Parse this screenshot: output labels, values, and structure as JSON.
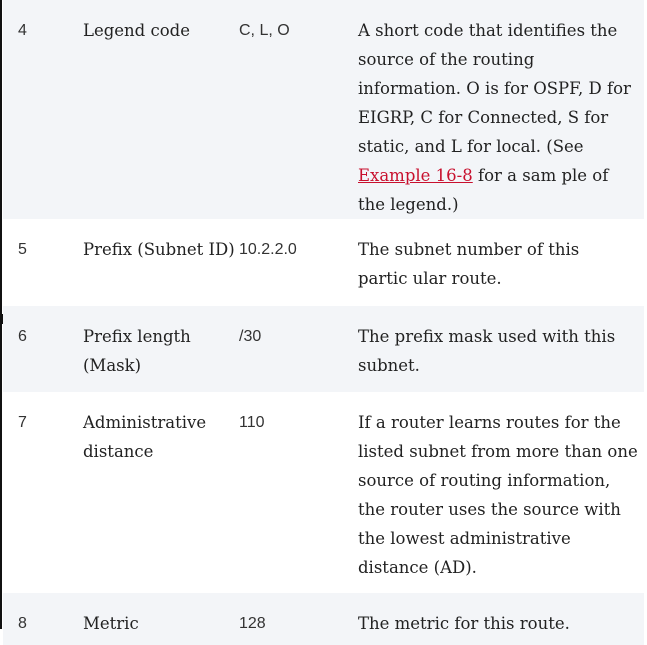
{
  "rows": [
    {
      "number": "4",
      "field": "Legend code",
      "value": "C, L, O",
      "description_before": "A short code that identifies the source of the routing information. O is for OSPF, D for EIGRP, C for Connected, S for static, and L for local. (See ",
      "link": "Example 16-8",
      "description_after": " for a sam­ ple of the legend.)"
    },
    {
      "number": "5",
      "field": "Prefix (Subnet ID)",
      "value": "10.2.2.0",
      "description": "The subnet number of this partic­ ular route."
    },
    {
      "number": "6",
      "field": "Prefix length (Mask)",
      "value": "/30",
      "description": "The prefix mask used with this subnet."
    },
    {
      "number": "7",
      "field": "Administrative distance",
      "value": "110",
      "description": "If a router learns routes for the listed subnet from more than one source of routing information, the router uses the source with the lowest administrative distance (AD)."
    },
    {
      "number": "8",
      "field": "Metric",
      "value": "128",
      "description": "The metric for this route."
    }
  ]
}
